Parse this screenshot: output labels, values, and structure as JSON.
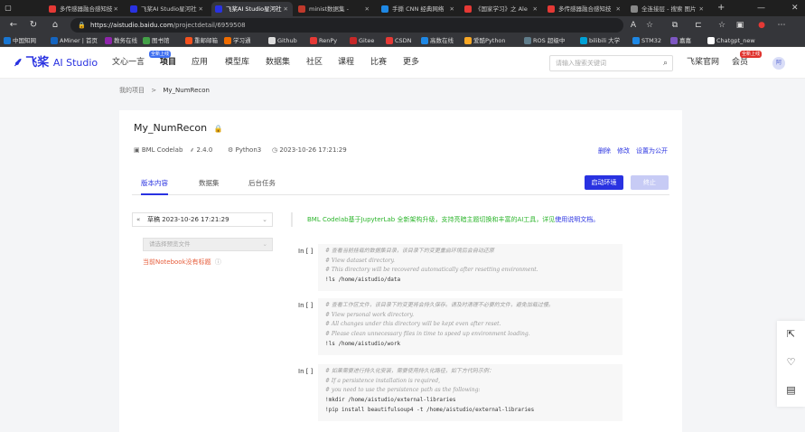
{
  "browser": {
    "tabs": [
      {
        "label": "多传感器融合感知技",
        "color": "#e53935"
      },
      {
        "label": "飞桨AI Studio星河社",
        "color": "#2932e1"
      },
      {
        "label": "飞桨AI Studio星河社",
        "color": "#2932e1"
      },
      {
        "label": "minist数据集 -",
        "color": "#c0392b"
      },
      {
        "label": "手撕 CNN 经典网络",
        "color": "#1e88e5"
      },
      {
        "label": "《国家学习》之 Ale",
        "color": "#e53935"
      },
      {
        "label": "多传感器融合感知技",
        "color": "#e53935"
      },
      {
        "label": "全连接层 - 搜索 图片",
        "color": "#888888"
      }
    ],
    "url_host": "https://aistudio.baidu.com",
    "url_path": "/projectdetail/6959508",
    "bookmarks": [
      {
        "label": "中国知网",
        "color": "#1976d2"
      },
      {
        "label": "AMiner | 首页",
        "color": "#1565c0"
      },
      {
        "label": "教务在线",
        "color": "#8e24aa"
      },
      {
        "label": "图书馆",
        "color": "#43a047"
      },
      {
        "label": "重邮邮箱",
        "color": "#f4511e"
      },
      {
        "label": "学习通",
        "color": "#ef6c00"
      },
      {
        "label": "Github",
        "color": "#dddddd"
      },
      {
        "label": "RenPy",
        "color": "#e53935"
      },
      {
        "label": "Gitee",
        "color": "#c62828"
      },
      {
        "label": "CSDN",
        "color": "#e53935"
      },
      {
        "label": "高数在线",
        "color": "#1e88e5"
      },
      {
        "label": "爱酷Python",
        "color": "#f9a825"
      },
      {
        "label": "ROS 超级中",
        "color": "#607d8b"
      },
      {
        "label": "bilibili 大学",
        "color": "#00a1d6"
      },
      {
        "label": "STM32",
        "color": "#1e88e5"
      },
      {
        "label": "嘉嘉",
        "color": "#7e57c2"
      },
      {
        "label": "Chatgpt_new",
        "color": "#ffffff"
      }
    ]
  },
  "site": {
    "logo_cn": "飞桨",
    "logo_en": "AI Studio",
    "nav": [
      "文心一言",
      "项目",
      "应用",
      "模型库",
      "数据集",
      "社区",
      "课程",
      "比赛",
      "更多"
    ],
    "nav_badge": "全新上线",
    "search_placeholder": "请输入搜索关键词",
    "official_site": "飞桨官网",
    "member": "会员",
    "member_badge": "全新上线",
    "avatar": "阿"
  },
  "breadcrumb": {
    "parent": "我的项目",
    "sep": ">",
    "current": "My_NumRecon"
  },
  "project": {
    "title": "My_NumRecon",
    "env": "BML Codelab",
    "version": "2.4.0",
    "lang": "Python3",
    "datetime": "2023-10-26 17:21:29",
    "actions": [
      "删除",
      "修改",
      "设置为公开"
    ],
    "tabs": [
      "版本内容",
      "数据集",
      "后台任务"
    ],
    "start_button": "启动环境",
    "stop_button": "终止",
    "version_select": "草稿 2023-10-26 17:21:29",
    "info_text": "BML Codelab基于JupyterLab 全新架构升级，支持亮暗主题切换和丰富的AI工具，详见",
    "info_link": "使用说明文档。",
    "file_placeholder": "请选择预览文件",
    "notebook_notitle": "当前Notebook没有标题"
  },
  "cells": [
    {
      "prompt": "In [ ]",
      "lines": [
        {
          "t": "# 查看当前挂载的数据集目录，该目录下的变更重启环境后会自动还原",
          "k": "c"
        },
        {
          "t": "# View dataset directory.",
          "k": "c"
        },
        {
          "t": "# This directory will be recovered automatically after resetting environment.",
          "k": "c"
        },
        {
          "t": "!ls /home/aistudio/data",
          "k": "k"
        }
      ]
    },
    {
      "prompt": "In [ ]",
      "lines": [
        {
          "t": "# 查看工作区文件，该目录下的变更将会持久保存。请及时清理不必要的文件，避免加载过慢。",
          "k": "c"
        },
        {
          "t": "# View personal work directory.",
          "k": "c"
        },
        {
          "t": "# All changes under this directory will be kept even after reset.",
          "k": "c"
        },
        {
          "t": "# Please clean unnecessary files in time to speed up environment loading.",
          "k": "c"
        },
        {
          "t": "!ls /home/aistudio/work",
          "k": "k"
        }
      ]
    },
    {
      "prompt": "In [ ]",
      "lines": [
        {
          "t": "# 如果需要进行持久化安装，需要使用持久化路径，如下方代码示例：",
          "k": "c"
        },
        {
          "t": "# If a persistence installation is required,",
          "k": "c"
        },
        {
          "t": "# you need to use the persistence path as the following:",
          "k": "c"
        },
        {
          "t": "!mkdir /home/aistudio/external-libraries",
          "k": "k"
        },
        {
          "t": "!pip install beautifulsoup4 -t /home/aistudio/external-libraries",
          "k": "k"
        }
      ]
    }
  ]
}
